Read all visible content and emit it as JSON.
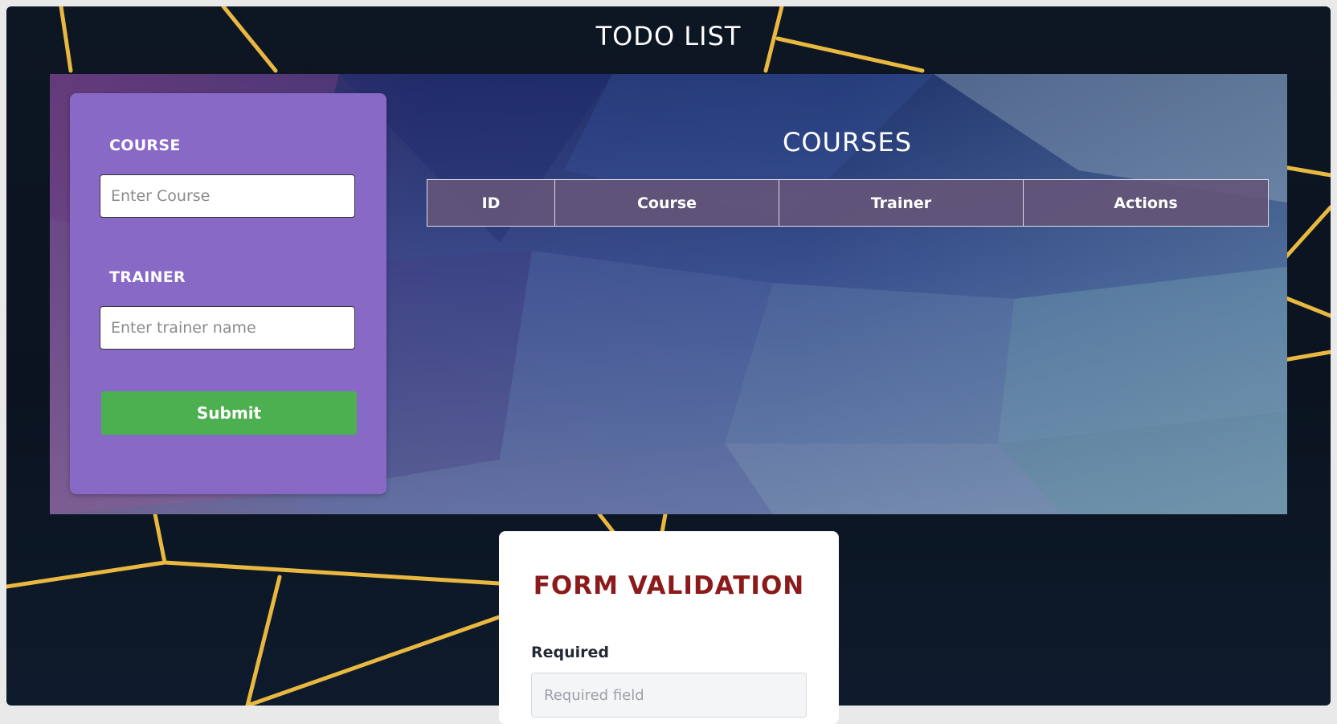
{
  "header": {
    "title": "TODO LIST"
  },
  "course_form": {
    "course_label": "COURSE",
    "course_placeholder": "Enter Course",
    "trainer_label": "TRAINER",
    "trainer_placeholder": "Enter trainer name",
    "submit_label": "Submit"
  },
  "courses": {
    "title": "COURSES",
    "columns": [
      "ID",
      "Course",
      "Trainer",
      "Actions"
    ],
    "rows": []
  },
  "validation": {
    "title": "FORM VALIDATION",
    "required_label": "Required",
    "required_placeholder": "Required field"
  },
  "colors": {
    "form_card": "#8869c6",
    "submit_button": "#4caf50",
    "validation_title": "#8b1a1a",
    "gold_lines": "#e8b840"
  }
}
